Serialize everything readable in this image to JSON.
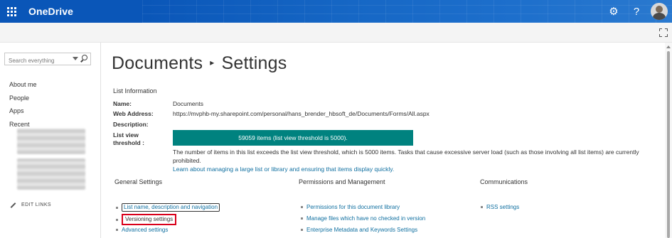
{
  "suite_bar": {
    "app_name": "OneDrive",
    "icons": [
      "waffle-icon",
      "gear-icon",
      "help-icon",
      "avatar"
    ],
    "help_glyph": "?",
    "gear_glyph": "⚙"
  },
  "left_nav": {
    "search_placeholder": "Search everything",
    "links": [
      "About me",
      "People",
      "Apps",
      "Recent"
    ],
    "edit_links": "EDIT LINKS"
  },
  "page": {
    "title_part1": "Documents",
    "title_part2": "Settings",
    "section_heading": "List Information",
    "fields": {
      "name_label": "Name:",
      "name_value": "Documents",
      "web_label": "Web Address:",
      "web_value": "https://mvphb-my.sharepoint.com/personal/hans_brender_hbsoft_de/Documents/Forms/All.aspx",
      "desc_label": "Description:",
      "threshold_label_line1": "List view",
      "threshold_label_line2": "threshold :"
    },
    "threshold_bar": "59059 items (list view threshold is 5000).",
    "warning_text": "The number of items in this list exceeds the list view threshold, which is 5000 items. Tasks that cause excessive server load (such as those involving all list items) are currently prohibited.",
    "learn_more": "Learn about managing a large list or library and ensuring that items display quickly."
  },
  "columns": {
    "general": {
      "heading": "General Settings",
      "links": [
        "List name, description and navigation",
        "Versioning settings",
        "Advanced settings"
      ]
    },
    "permissions": {
      "heading": "Permissions and Management",
      "links": [
        "Permissions for this document library",
        "Manage files which have no checked in version",
        "Enterprise Metadata and Keywords Settings"
      ]
    },
    "communications": {
      "heading": "Communications",
      "links": [
        "RSS settings"
      ]
    }
  },
  "colors": {
    "suite_bar": "#0a56b8",
    "threshold_bar": "#00827f",
    "link": "#0f6fa0",
    "highlight_red": "#d9001b"
  }
}
